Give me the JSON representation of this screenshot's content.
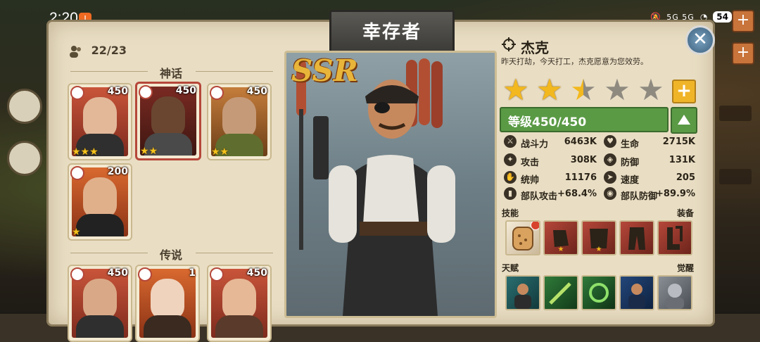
{
  "status_bar": {
    "time": "2:20",
    "app_badge": "!",
    "network": "5G 5G",
    "battery": "54"
  },
  "window": {
    "title": "幸存者",
    "close_label": "✕"
  },
  "roster": {
    "count": "22/23",
    "sections": [
      {
        "title": "神话"
      },
      {
        "title": "传说"
      }
    ],
    "cards": [
      {
        "level": "450",
        "stars": "★★★"
      },
      {
        "level": "450",
        "stars": "★★"
      },
      {
        "level": "450",
        "stars": "★★"
      },
      {
        "level": "200",
        "stars": "★"
      },
      {
        "level": "450",
        "stars": ""
      },
      {
        "level": "1",
        "stars": ""
      },
      {
        "level": "450",
        "stars": ""
      }
    ]
  },
  "hero": {
    "rarity": "SSR",
    "name": "杰克",
    "description": "昨天打劫，今天打工，杰克愿意为您效劳。",
    "stars_filled": 2.5,
    "stars_total": 5,
    "level_text": "等级450/450",
    "stats": {
      "power_label": "战斗力",
      "power_value": "6463K",
      "hp_label": "生命",
      "hp_value": "2715K",
      "attack_label": "攻击",
      "attack_value": "308K",
      "defense_label": "防御",
      "defense_value": "131K",
      "command_label": "统帅",
      "command_value": "11176",
      "speed_label": "速度",
      "speed_value": "205",
      "troop_attack_label": "部队攻击",
      "troop_attack_value": "+68.4%",
      "troop_defense_label": "部队防御",
      "troop_defense_value": "+89.9%"
    },
    "labels": {
      "skills": "技能",
      "equipment": "装备",
      "talent": "天赋",
      "awaken": "觉醒"
    }
  },
  "colors": {
    "parchment": "#e9dec4",
    "accent_red": "#b5473a",
    "level_green": "#5a9a45",
    "star_gold": "#f2b81e"
  }
}
